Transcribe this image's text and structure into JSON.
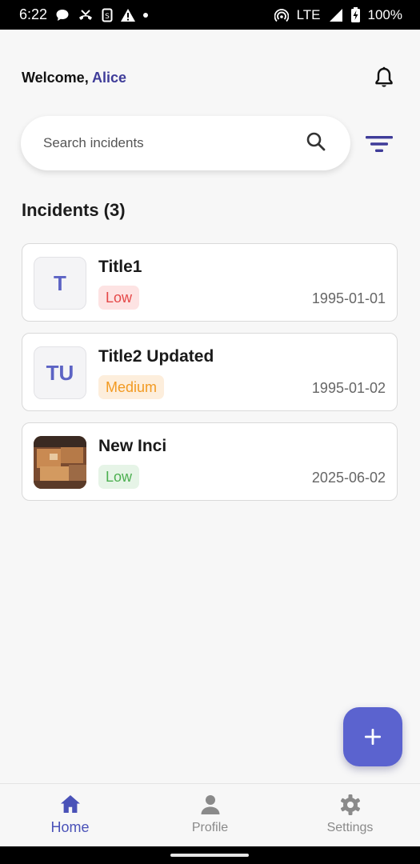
{
  "status_bar": {
    "time": "6:22",
    "network": "LTE",
    "battery": "100%"
  },
  "header": {
    "welcome_prefix": "Welcome, ",
    "user_name": "Alice"
  },
  "search": {
    "placeholder": "Search incidents",
    "value": ""
  },
  "incidents": {
    "title": "Incidents (3)",
    "items": [
      {
        "initials": "T",
        "title": "Title1",
        "severity": "Low",
        "date": "1995-01-01"
      },
      {
        "initials": "TU",
        "title": "Title2 Updated",
        "severity": "Medium",
        "date": "1995-01-02"
      },
      {
        "initials": "",
        "title": "New Inci",
        "severity": "Low",
        "date": "2025-06-02"
      }
    ]
  },
  "nav": {
    "items": [
      {
        "label": "Home"
      },
      {
        "label": "Profile"
      },
      {
        "label": "Settings"
      }
    ]
  },
  "colors": {
    "accent": "#5b63cf",
    "user_name": "#3f3c99",
    "low_red": "#e54848",
    "medium_orange": "#f29a22",
    "low_green": "#4caf50"
  }
}
